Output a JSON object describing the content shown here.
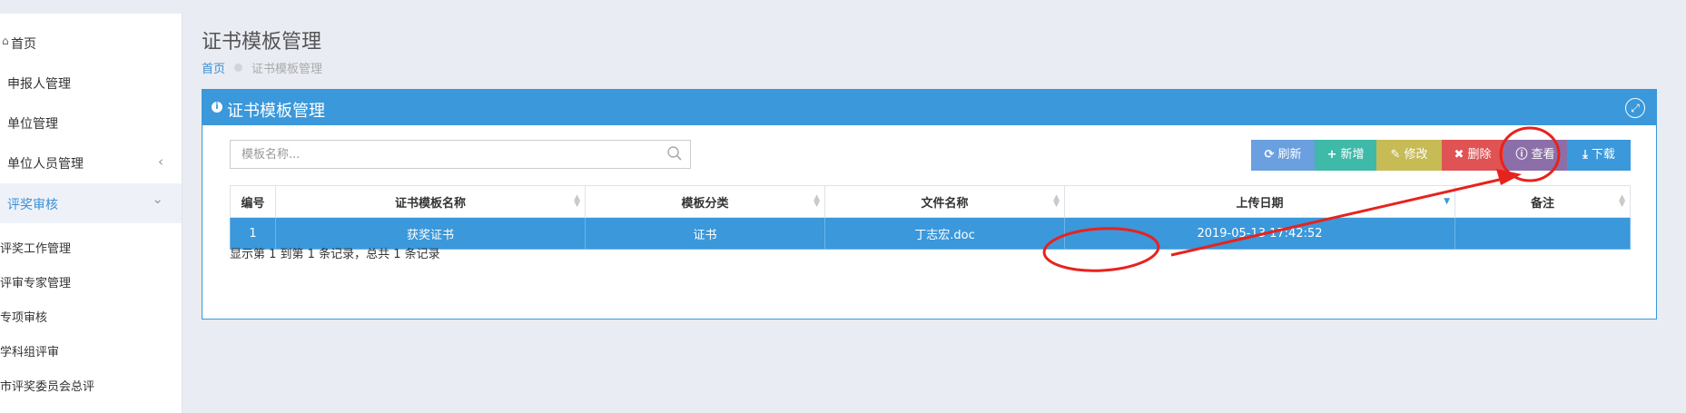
{
  "sidebar": {
    "items": [
      {
        "label": "首页",
        "icon": "home-icon"
      },
      {
        "label": "申报人管理",
        "icon": ""
      },
      {
        "label": "单位管理",
        "icon": ""
      },
      {
        "label": "单位人员管理",
        "icon": "",
        "chevron": "‹"
      },
      {
        "label": "评奖审核",
        "icon": "",
        "chevron": "⌄"
      }
    ],
    "subitems": [
      {
        "label": "评奖工作管理"
      },
      {
        "label": "评审专家管理"
      },
      {
        "label": "专项审核"
      },
      {
        "label": "学科组评审"
      },
      {
        "label": "市评奖委员会总评"
      }
    ]
  },
  "header": {
    "title": "证书模板管理",
    "breadcrumb": {
      "home": "首页",
      "current": "证书模板管理"
    }
  },
  "panel": {
    "title": "证书模板管理"
  },
  "search": {
    "placeholder": "模板名称..."
  },
  "toolbar": {
    "refresh": "刷新",
    "add": "新增",
    "edit": "修改",
    "delete": "删除",
    "view": "查看",
    "download": "下载",
    "colors": {
      "refresh": "#6a9fe0",
      "add": "#3fb9a8",
      "edit": "#c6bb55",
      "delete": "#e05355",
      "view": "#8c6fa8",
      "download": "#3a98db"
    }
  },
  "table": {
    "columns": [
      "编号",
      "证书模板名称",
      "模板分类",
      "文件名称",
      "上传日期",
      "备注"
    ],
    "rows": [
      {
        "id": "1",
        "name": "获奖证书",
        "category": "证书",
        "file": "丁志宏.doc",
        "date": "2019-05-13 17:42:52",
        "note": ""
      }
    ]
  },
  "summary": "显示第 1 到第 1 条记录，总共 1 条记录",
  "colors": {
    "accent": "#3a98db",
    "annotation": "#e8221c"
  }
}
